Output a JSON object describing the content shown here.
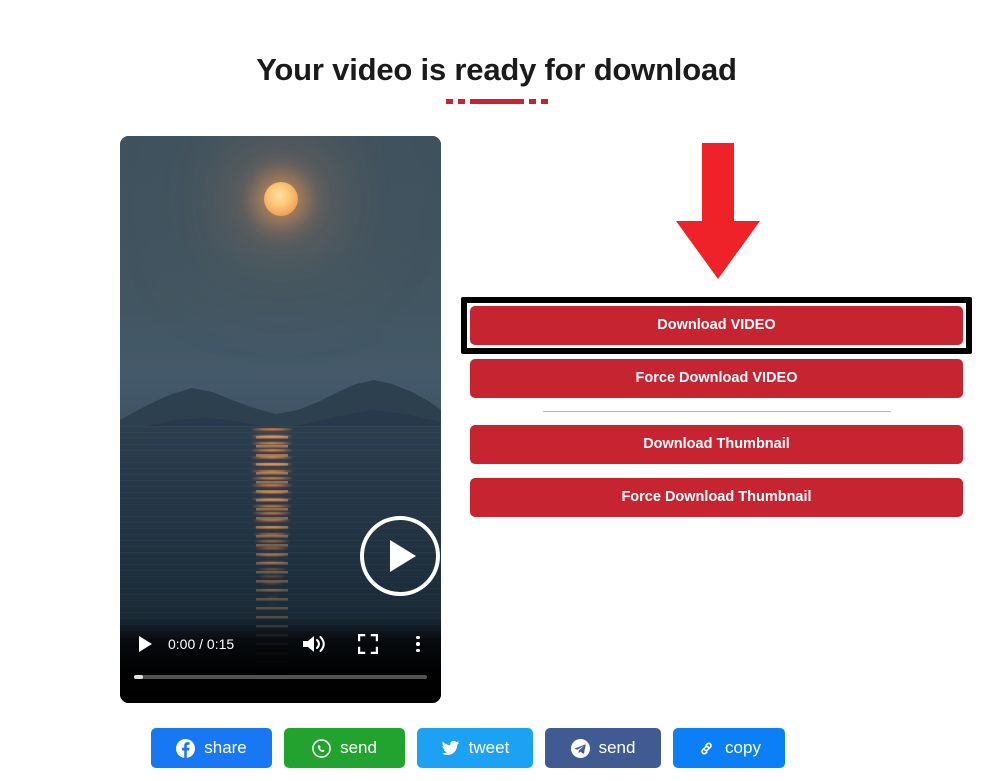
{
  "page": {
    "title": "Your video is ready for download",
    "accent_red": "#c62431",
    "arrow_red": "#ee2228",
    "background": "#ffffff"
  },
  "video_player": {
    "name": "video-preview",
    "play_overlay_icon": "play-circle-icon",
    "scene_description": "moon over water with reflection",
    "controls": {
      "play_icon": "play-icon",
      "time_display": "0:00 / 0:15",
      "current_time": "0:00",
      "duration": "0:15",
      "volume_icon": "volume-icon",
      "fullscreen_icon": "fullscreen-icon",
      "more_icon": "more-vertical-icon",
      "progress_percent": 3
    }
  },
  "annotation": {
    "arrow_icon": "down-arrow-icon",
    "highlight_target": "download-video-button"
  },
  "download_buttons": {
    "video": [
      {
        "label": "Download VIDEO",
        "name": "download-video-button",
        "highlighted": true
      },
      {
        "label": "Force Download VIDEO",
        "name": "force-download-video-button",
        "highlighted": false
      }
    ],
    "thumbnail": [
      {
        "label": "Download Thumbnail",
        "name": "download-thumbnail-button",
        "highlighted": false
      },
      {
        "label": "Force Download Thumbnail",
        "name": "force-download-thumbnail-button",
        "highlighted": false
      }
    ]
  },
  "social_buttons": [
    {
      "label": "share",
      "name": "facebook-share-button",
      "icon": "facebook-icon",
      "color": "#1877f2"
    },
    {
      "label": "send",
      "name": "whatsapp-send-button",
      "icon": "whatsapp-icon",
      "color": "#22a32f"
    },
    {
      "label": "tweet",
      "name": "twitter-tweet-button",
      "icon": "twitter-icon",
      "color": "#1da1f2"
    },
    {
      "label": "send",
      "name": "telegram-send-button",
      "icon": "telegram-icon",
      "color": "#3f5b92"
    },
    {
      "label": "copy",
      "name": "copy-link-button",
      "icon": "link-icon",
      "color": "#0b7ff5"
    }
  ]
}
